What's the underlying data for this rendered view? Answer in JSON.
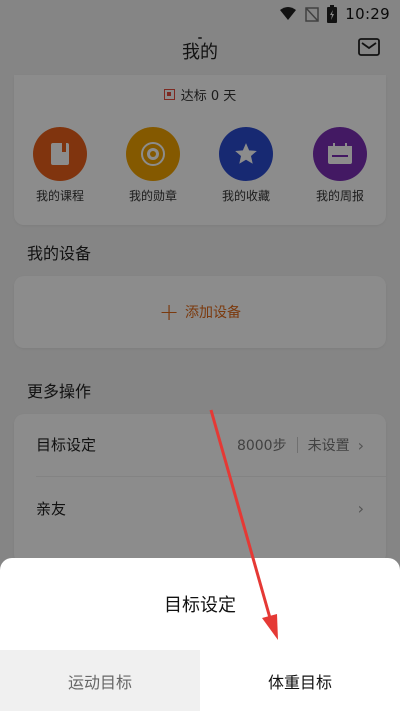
{
  "status_bar": {
    "time": "10:29"
  },
  "header": {
    "title": "我的"
  },
  "stats": {
    "streak_text": "达标 0 天"
  },
  "quick_actions": [
    {
      "label": "我的课程",
      "color": "#e9601b",
      "icon": "book-icon"
    },
    {
      "label": "我的勋章",
      "color": "#f0a200",
      "icon": "medal-icon"
    },
    {
      "label": "我的收藏",
      "color": "#2b4bd0",
      "icon": "star-icon"
    },
    {
      "label": "我的周报",
      "color": "#7a2fb5",
      "icon": "report-icon"
    }
  ],
  "devices": {
    "section_title": "我的设备",
    "add_label": "添加设备"
  },
  "more": {
    "section_title": "更多操作",
    "items": [
      {
        "label": "目标设定",
        "value": "8000步",
        "value2": "未设置"
      },
      {
        "label": "亲友"
      }
    ]
  },
  "sheet": {
    "title": "目标设定",
    "tabs": [
      {
        "label": "运动目标",
        "active": false
      },
      {
        "label": "体重目标",
        "active": true
      }
    ]
  },
  "colors": {
    "accent": "#e06a1b",
    "annotation_arrow": "#e53935"
  }
}
